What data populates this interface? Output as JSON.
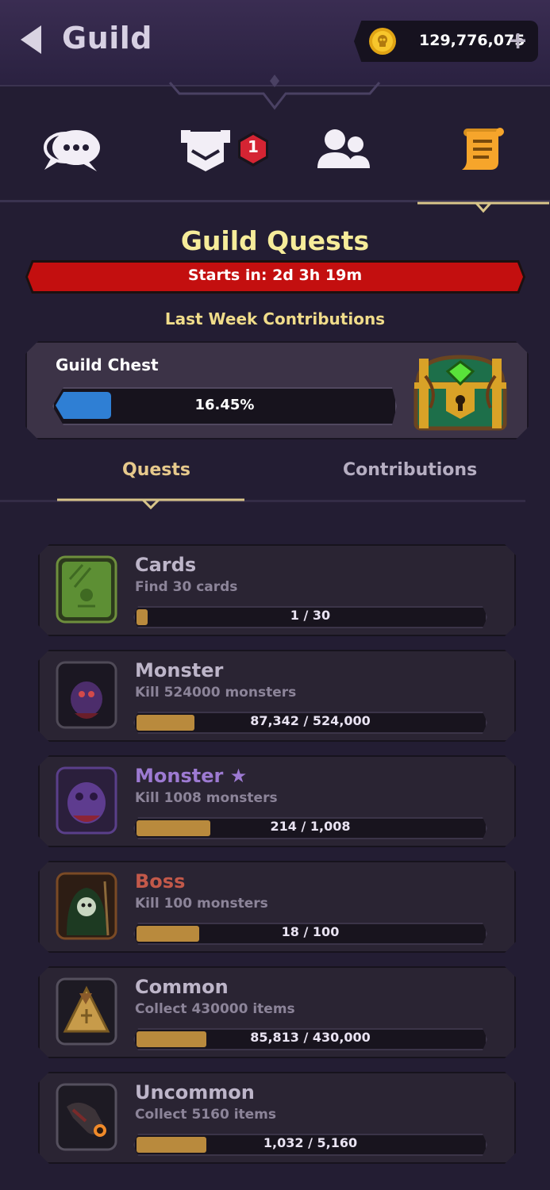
{
  "header": {
    "title": "Guild",
    "coins": "129,776,075",
    "plus_label": "+"
  },
  "tabs": [
    {
      "name": "chat-icon",
      "active": false
    },
    {
      "name": "banner-icon",
      "active": false,
      "badge": "1"
    },
    {
      "name": "members-icon",
      "active": false
    },
    {
      "name": "scroll-icon",
      "active": true
    }
  ],
  "quests_section": {
    "title": "Guild Quests",
    "timer": "Starts in: 2d 3h 19m",
    "subheading": "Last Week Contributions",
    "chest": {
      "label": "Guild Chest",
      "progress_text": "16.45%",
      "progress": 0.1645
    }
  },
  "list_tabs": {
    "quests": "Quests",
    "contributions": "Contributions",
    "active": "quests"
  },
  "quests": [
    {
      "name": "Cards",
      "desc": "Find 30 cards",
      "progress": "1 / 30",
      "fraction": 0.033,
      "name_color": "#bdb5c9",
      "icon": "card-icon",
      "star": ""
    },
    {
      "name": "Monster",
      "desc": "Kill 524000 monsters",
      "progress": "87,342 / 524,000",
      "fraction": 0.167,
      "name_color": "#bdb5c9",
      "icon": "monster-icon",
      "star": ""
    },
    {
      "name": "Monster",
      "desc": "Kill 1008 monsters",
      "progress": "214 / 1,008",
      "fraction": 0.212,
      "name_color": "#9d7ad2",
      "icon": "epic-monster-icon",
      "star": "★"
    },
    {
      "name": "Boss",
      "desc": "Kill 100 monsters",
      "progress": "18 / 100",
      "fraction": 0.18,
      "name_color": "#c3594a",
      "icon": "boss-icon",
      "star": ""
    },
    {
      "name": "Common",
      "desc": "Collect 430000 items",
      "progress": "85,813 / 430,000",
      "fraction": 0.2,
      "name_color": "#bdb5c9",
      "icon": "common-item-icon",
      "star": ""
    },
    {
      "name": "Uncommon",
      "desc": "Collect 5160 items",
      "progress": "1,032 / 5,160",
      "fraction": 0.2,
      "name_color": "#bdb5c9",
      "icon": "uncommon-item-icon",
      "star": ""
    }
  ]
}
